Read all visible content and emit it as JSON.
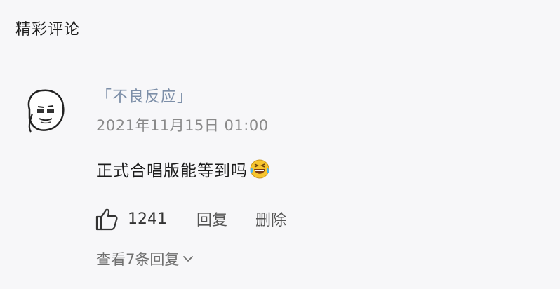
{
  "section": {
    "title": "精彩评论"
  },
  "comment": {
    "avatar_icon": "meme-face-avatar",
    "username": "「不良反应」",
    "timestamp": "2021年11月15日 01:00",
    "text": "正式合唱版能等到吗",
    "emoji_icon": "laughing-crying-emoji",
    "like_icon": "thumbs-up-icon",
    "like_count": "1241",
    "reply_label": "回复",
    "delete_label": "删除",
    "view_replies_label": "查看7条回复",
    "chevron_icon": "chevron-down-icon"
  },
  "colors": {
    "background": "#f7f7f9",
    "username": "#7d8fa8",
    "timestamp": "#8a8a8a"
  }
}
